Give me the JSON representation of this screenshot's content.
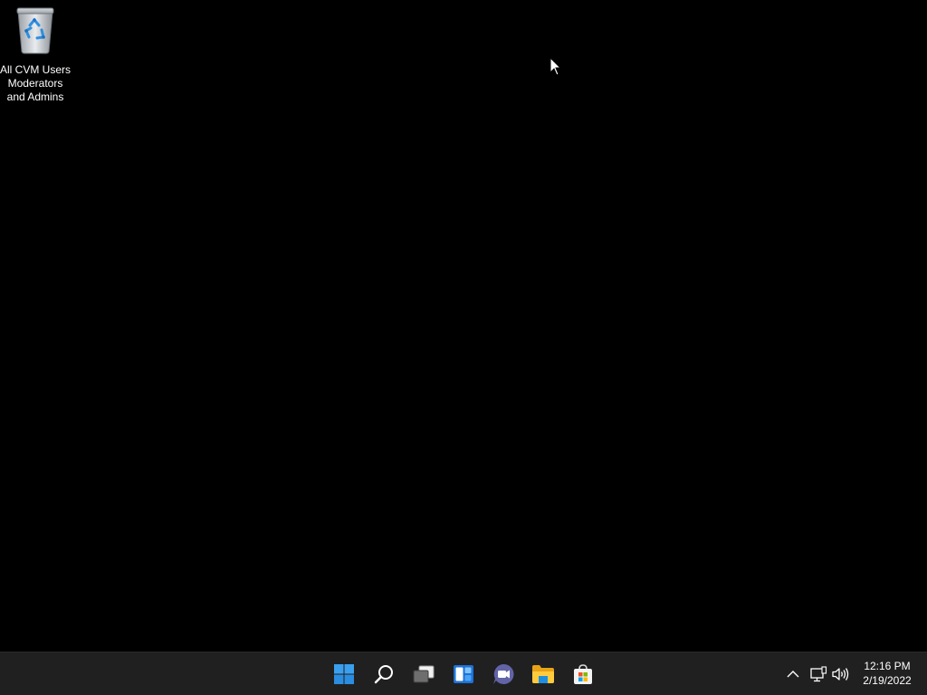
{
  "desktop": {
    "background": "#000000",
    "icons": [
      {
        "label": "All CVM Users\nModerators\nand Admins",
        "icon": "recycle-bin-icon"
      }
    ]
  },
  "taskbar": {
    "background": "#202020",
    "pinned": [
      {
        "name": "start-button",
        "icon": "windows-logo-icon"
      },
      {
        "name": "search-button",
        "icon": "search-icon"
      },
      {
        "name": "task-view-button",
        "icon": "task-view-icon"
      },
      {
        "name": "widgets-button",
        "icon": "widgets-icon"
      },
      {
        "name": "chat-button",
        "icon": "teams-chat-icon"
      },
      {
        "name": "file-explorer-button",
        "icon": "folder-icon"
      },
      {
        "name": "microsoft-store-button",
        "icon": "store-icon"
      }
    ],
    "tray": {
      "icons": [
        "chevron-up-icon",
        "network-icon",
        "volume-icon"
      ]
    },
    "clock": {
      "time": "12:16 PM",
      "date": "2/19/2022"
    }
  }
}
